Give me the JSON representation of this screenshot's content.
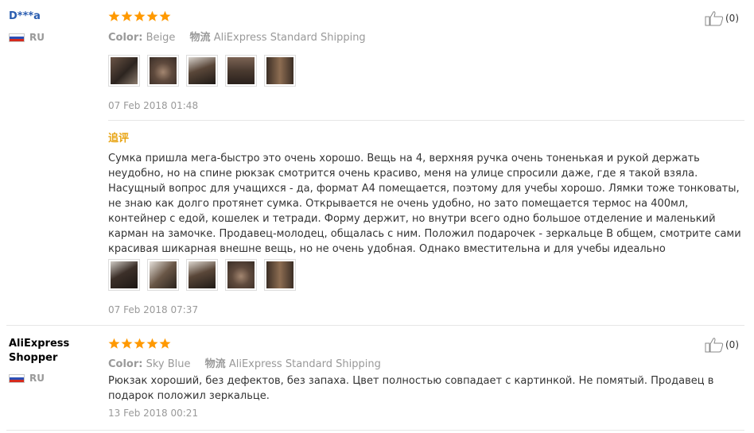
{
  "reviews": [
    {
      "buyer": "D***a",
      "country": "RU",
      "stars": 5,
      "color_label": "Color:",
      "color_value": "Beige",
      "shipping_label": "物流",
      "shipping_value": "AliExpress Standard Shipping",
      "date": "07 Feb 2018 01:48",
      "helpful_count": "(0)",
      "append_title": "追评",
      "append_text": "Сумка пришла мега-быстро это очень хорошо. Вещь на 4, верхняя ручка очень тоненькая и рукой держать неудобно, но на спине рюкзак смотрится очень красиво, меня на улице спросили даже, где я такой взяла. Насущный вопрос для учащихся - да, формат А4 помещается, поэтому для учебы хорошо. Лямки тоже тонковаты, не знаю как долго протянет сумка. Открывается не очень удобно, но зато помещается термос на 400мл, контейнер с едой, кошелек и тетради. Форму держит, но внутри всего одно большое отделение и маленький карман на замочке. Продавец-молодец, общалась с ним. Положил подарочек - зеркальце В общем, смотрите сами красивая шикарная внешне вещь, но не очень удобная. Однако вместительна и для учебы идеально",
      "append_date": "07 Feb 2018 07:37"
    },
    {
      "buyer_line1": "AliExpress",
      "buyer_line2": "Shopper",
      "country": "RU",
      "stars": 5,
      "color_label": "Color:",
      "color_value": "Sky Blue",
      "shipping_label": "物流",
      "shipping_value": "AliExpress Standard Shipping",
      "text": "Рюкзак хороший, без дефектов, без запаха. Цвет полностью совпадает с картинкой. Не помятый. Продавец в подарок положил зеркальце.",
      "date": "13 Feb 2018 00:21",
      "helpful_count": "(0)"
    }
  ],
  "colors": {
    "star": "#ff9900",
    "append_title": "#e8a413",
    "meta_text": "#999999",
    "buyer_link": "#2a5db0"
  },
  "icons": {
    "star": "star-icon",
    "helpful": "thumbs-up-icon",
    "flag": "russia-flag-icon"
  }
}
